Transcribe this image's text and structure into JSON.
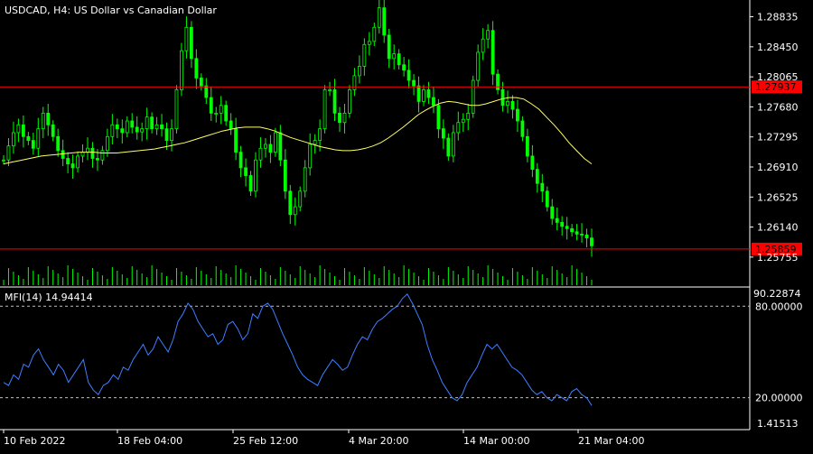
{
  "chart": {
    "title": "USDCAD, H4:  US Dollar vs Canadian Dollar",
    "background": "#000000",
    "candle_color": "#00ff00",
    "ma_color": "#ffff66",
    "hline_color": "#ff0000",
    "mfi_color": "#3f7fff"
  },
  "price_axis": {
    "ticks": [
      "1.28835",
      "1.28450",
      "1.28065",
      "1.27680",
      "1.27295",
      "1.26910",
      "1.26525",
      "1.26140",
      "1.25755"
    ],
    "range": [
      1.2558,
      1.2905
    ]
  },
  "hlines": [
    {
      "label": "1.27937",
      "value": 1.27937
    },
    {
      "label": "1.25859",
      "value": 1.25859
    }
  ],
  "indicator": {
    "label": "MFI(14) 14.94414",
    "max_label": "90.22874",
    "min_label": "1.41513",
    "levels": [
      "80.00000",
      "20.00000"
    ],
    "range": [
      1.41513,
      90.22874
    ],
    "level_values": [
      80,
      20
    ]
  },
  "time_axis": {
    "labels": [
      "10 Feb 2022",
      "18 Feb 04:00",
      "25 Feb 12:00",
      "4 Mar 20:00",
      "14 Mar 00:00",
      "21 Mar 04:00"
    ]
  },
  "chart_data": {
    "type": "line",
    "title": "USDCAD, H4:  US Dollar vs Canadian Dollar",
    "x_labels": [
      "10 Feb 2022",
      "18 Feb 04:00",
      "25 Feb 12:00",
      "4 Mar 20:00",
      "14 Mar 00:00",
      "21 Mar 04:00"
    ],
    "ylim": [
      1.2558,
      1.2905
    ],
    "series": [
      {
        "values": [
          1.27,
          1.2718,
          1.2735,
          1.2745,
          1.273,
          1.2725,
          1.2715,
          1.274,
          1.276,
          1.2745,
          1.273,
          1.2712,
          1.2702,
          1.2695,
          1.269,
          1.2705,
          1.271,
          1.2715,
          1.2702,
          1.27,
          1.2712,
          1.273,
          1.2745,
          1.274,
          1.2735,
          1.275,
          1.2742,
          1.2736,
          1.274,
          1.2755,
          1.274,
          1.2745,
          1.274,
          1.2725,
          1.274,
          1.279,
          1.284,
          1.287,
          1.283,
          1.2805,
          1.2795,
          1.278,
          1.276,
          1.276,
          1.277,
          1.275,
          1.274,
          1.271,
          1.269,
          1.268,
          1.266,
          1.27,
          1.2715,
          1.272,
          1.271,
          1.2735,
          1.27,
          1.266,
          1.263,
          1.264,
          1.266,
          1.269,
          1.272,
          1.2725,
          1.274,
          1.279,
          1.279,
          1.276,
          1.2748,
          1.276,
          1.279,
          1.2808,
          1.282,
          1.2848,
          1.2852,
          1.287,
          1.2895,
          1.286,
          1.283,
          1.2836,
          1.2822,
          1.2815,
          1.2802,
          1.2795,
          1.2775,
          1.279,
          1.278,
          1.277,
          1.274,
          1.2728,
          1.2705,
          1.2735,
          1.2748,
          1.2752,
          1.276,
          1.2802,
          1.2838,
          1.2855,
          1.2866,
          1.281,
          1.279,
          1.277,
          1.2775,
          1.2765,
          1.275,
          1.273,
          1.2705,
          1.2688,
          1.267,
          1.266,
          1.264,
          1.2625,
          1.262,
          1.2615,
          1.2612,
          1.2608,
          1.2605,
          1.2604,
          1.26,
          1.259
        ],
        "color": "#00ff00"
      },
      {
        "values": [
          1.2695,
          1.2697,
          1.2699,
          1.2701,
          1.2703,
          1.2705,
          1.2706,
          1.2707,
          1.2708,
          1.2709,
          1.271,
          1.271,
          1.271,
          1.2709,
          1.2709,
          1.2709,
          1.271,
          1.2711,
          1.2712,
          1.2713,
          1.2714,
          1.2716,
          1.2718,
          1.272,
          1.2722,
          1.2725,
          1.2728,
          1.2731,
          1.2734,
          1.2737,
          1.2739,
          1.2741,
          1.2742,
          1.2742,
          1.2742,
          1.274,
          1.2737,
          1.2733,
          1.2729,
          1.2726,
          1.2723,
          1.272,
          1.2717,
          1.2715,
          1.2713,
          1.2712,
          1.2712,
          1.2713,
          1.2715,
          1.2718,
          1.2722,
          1.2728,
          1.2735,
          1.2742,
          1.275,
          1.2758,
          1.2764,
          1.2769,
          1.2773,
          1.2775,
          1.2774,
          1.2772,
          1.277,
          1.277,
          1.2772,
          1.2775,
          1.2778,
          1.278,
          1.278,
          1.2778,
          1.2772,
          1.2765,
          1.2755,
          1.2745,
          1.2734,
          1.2722,
          1.2712,
          1.2702,
          1.2695
        ],
        "color": "#ffff66"
      },
      {
        "values": [
          30,
          28,
          35,
          32,
          42,
          40,
          48,
          52,
          45,
          40,
          35,
          42,
          38,
          30,
          35,
          40,
          45,
          30,
          25,
          22,
          28,
          30,
          35,
          32,
          40,
          38,
          45,
          50,
          55,
          48,
          52,
          60,
          55,
          50,
          58,
          70,
          75,
          82,
          78,
          70,
          65,
          60,
          62,
          55,
          58,
          68,
          70,
          65,
          58,
          62,
          75,
          72,
          80,
          82,
          78,
          70,
          62,
          55,
          48,
          40,
          35,
          32,
          30,
          28,
          35,
          40,
          45,
          42,
          38,
          40,
          48,
          55,
          60,
          58,
          65,
          70,
          72,
          75,
          78,
          80,
          85,
          88,
          82,
          75,
          68,
          55,
          45,
          38,
          30,
          25,
          20,
          18,
          22,
          30,
          35,
          40,
          48,
          55,
          52,
          55,
          50,
          45,
          40,
          38,
          35,
          30,
          25,
          22,
          24,
          20,
          18,
          22,
          20,
          18,
          24,
          26,
          22,
          20,
          14.94
        ],
        "color": "#3f7fff"
      }
    ]
  }
}
